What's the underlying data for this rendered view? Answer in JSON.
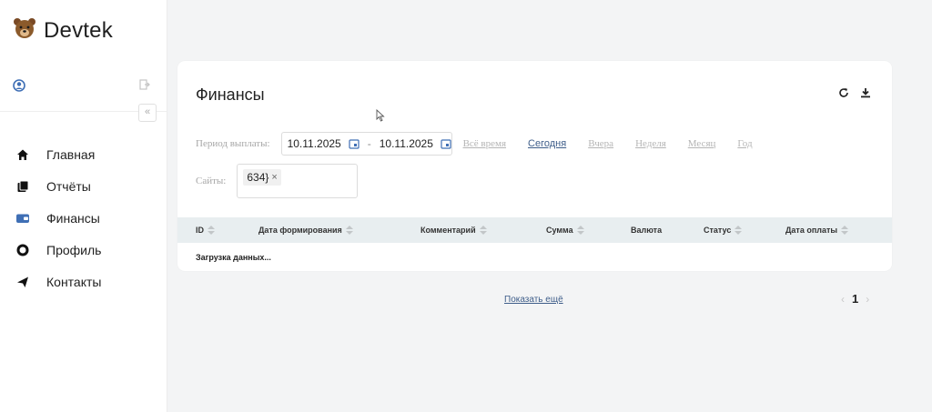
{
  "brand": {
    "name": "Devtek"
  },
  "sidebar": {
    "items": [
      {
        "label": "Главная",
        "icon": "home-icon"
      },
      {
        "label": "Отчёты",
        "icon": "reports-icon"
      },
      {
        "label": "Финансы",
        "icon": "wallet-icon",
        "color": "#3f6fb5"
      },
      {
        "label": "Профиль",
        "icon": "gear-icon"
      },
      {
        "label": "Контакты",
        "icon": "paper-plane-icon"
      }
    ],
    "collapse_glyph": "«"
  },
  "page": {
    "title": "Финансы"
  },
  "filters": {
    "period_label": "Период выплаты:",
    "date_from": "10.11.2025",
    "date_sep": "-",
    "date_to": "10.11.2025",
    "quick": [
      {
        "label": "Всё время",
        "active": false
      },
      {
        "label": "Сегодня",
        "active": true
      },
      {
        "label": "Вчера",
        "active": false
      },
      {
        "label": "Неделя",
        "active": false
      },
      {
        "label": "Месяц",
        "active": false
      },
      {
        "label": "Год",
        "active": false
      }
    ],
    "sites_label": "Сайты:",
    "sites_tag": "634}",
    "tag_remove": "×"
  },
  "table": {
    "columns": [
      {
        "label": "ID",
        "sortable": true
      },
      {
        "label": "Дата формирования",
        "sortable": true
      },
      {
        "label": "Комментарий",
        "sortable": true
      },
      {
        "label": "Сумма",
        "sortable": true
      },
      {
        "label": "Валюта",
        "sortable": false
      },
      {
        "label": "Статус",
        "sortable": true
      },
      {
        "label": "Дата оплаты",
        "sortable": true
      }
    ],
    "loading": "Загрузка данных..."
  },
  "footer": {
    "show_more": "Показать ещё",
    "prev": "‹",
    "page": "1",
    "next": "›"
  },
  "colors": {
    "accent": "#3f5e8a",
    "table_header": "#e8eef0",
    "sidebar_active": "#3f6fb5"
  }
}
